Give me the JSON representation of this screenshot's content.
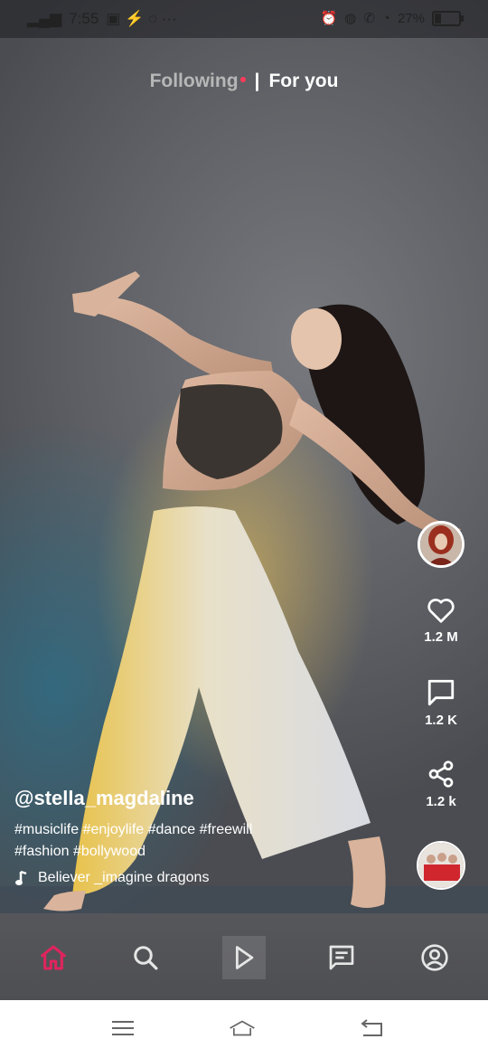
{
  "status_bar": {
    "time": "7:55",
    "battery_percent": "27",
    "battery_level": 0.27
  },
  "top_tabs": {
    "following": "Following",
    "for_you": "For you",
    "separator": "|"
  },
  "actions": {
    "likes": "1.2 M",
    "comments": "1.2 K",
    "shares": "1.2 k"
  },
  "post": {
    "username": "@stella_magdaline",
    "hashtags": "#musiclife #enjoylife #dance #freewill #fashion #bollywood",
    "song": "Believer _imagine dragons"
  },
  "bottom_nav": {
    "items": [
      "home-icon",
      "search-icon",
      "play-icon",
      "chat-icon",
      "profile-icon"
    ],
    "active": "home-icon",
    "active_color": "#e0245e"
  },
  "system_nav": [
    "menu-icon",
    "home-outline-icon",
    "back-icon"
  ],
  "colors": {
    "accent": "#ff3b5c",
    "active_nav": "#e0245e"
  }
}
